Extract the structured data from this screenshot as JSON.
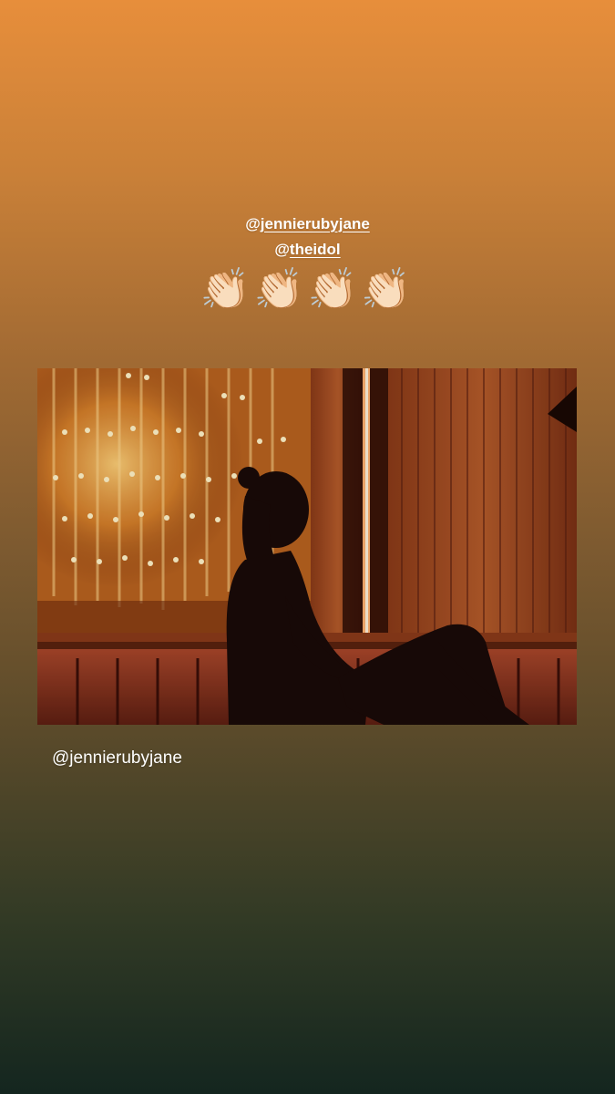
{
  "story": {
    "mentions": [
      {
        "at": "@",
        "handle": "jennierubyjane"
      },
      {
        "at": "@",
        "handle": "theidol"
      }
    ],
    "sticker_emoji": "👏🏻👏🏻👏🏻👏🏻",
    "caption": "@jennierubyjane"
  },
  "colors": {
    "gradient_top": "#e78e3b",
    "gradient_bottom": "#14261f",
    "text": "#ffffff"
  }
}
